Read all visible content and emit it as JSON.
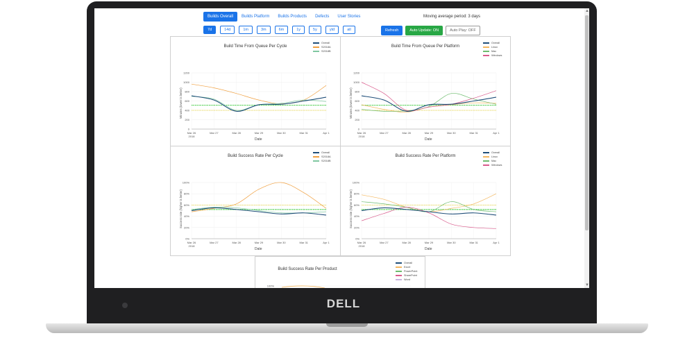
{
  "device": {
    "logo": "DELL"
  },
  "nav": {
    "tabs": [
      {
        "label": "Builds Overall",
        "active": true
      },
      {
        "label": "Builds Platform",
        "active": false
      },
      {
        "label": "Builds Products",
        "active": false
      },
      {
        "label": "Defects",
        "active": false
      },
      {
        "label": "User Stories",
        "active": false
      }
    ],
    "moving_average": "Moving average period: 3 days"
  },
  "periods": [
    {
      "label": "7d",
      "active": true
    },
    {
      "label": "14d",
      "active": false
    },
    {
      "label": "1m",
      "active": false
    },
    {
      "label": "3m",
      "active": false
    },
    {
      "label": "6m",
      "active": false
    },
    {
      "label": "1y",
      "active": false
    },
    {
      "label": "5y",
      "active": false
    },
    {
      "label": "ytd",
      "active": false
    },
    {
      "label": "all",
      "active": false
    }
  ],
  "controls": {
    "refresh": "Refresh",
    "auto_update": "Auto Update: ON",
    "auto_play": "Auto Play: OFF"
  },
  "colors": {
    "Overall": "#1f4e79",
    "S2018A": "#f0a040",
    "S2018B": "#7fc7a0",
    "Linux": "#f4b860",
    "Mac": "#6dbb6d",
    "Windows": "#d95b8c",
    "Excel": "#f4b860",
    "PowerPoint": "#6dbb6d",
    "SharePoint": "#d95b8c",
    "Word": "#c9b3e0",
    "target_yellow": "#e8d230",
    "target_green": "#38c838"
  },
  "chart_data": [
    {
      "type": "line",
      "title": "Build Time From Queue Per Cycle",
      "xlabel": "Date",
      "ylabel": "Minutes (lower is better)",
      "x": [
        "Mar 26",
        "Mar 27",
        "Mar 28",
        "Mar 29",
        "Mar 30",
        "Mar 31",
        "Apr 1"
      ],
      "x_first_sub": "2018",
      "yticks": [
        "0",
        "200",
        "400",
        "600",
        "800",
        "1000",
        "1200"
      ],
      "ylim": [
        0,
        1200
      ],
      "series": [
        {
          "name": "Overall",
          "values": [
            710,
            620,
            380,
            520,
            530,
            600,
            680
          ]
        },
        {
          "name": "S2018A",
          "values": [
            960,
            880,
            760,
            620,
            540,
            620,
            930
          ]
        },
        {
          "name": "S2018B",
          "values": [
            700,
            640,
            400,
            520,
            550,
            620,
            590
          ]
        }
      ],
      "targets": [
        {
          "color": "yellow",
          "value": 400
        },
        {
          "color": "green",
          "value": 510
        }
      ]
    },
    {
      "type": "line",
      "title": "Build Time From Queue Per Platform",
      "xlabel": "Date",
      "ylabel": "Minutes (lower is better)",
      "x": [
        "Mar 26",
        "Mar 27",
        "Mar 28",
        "Mar 29",
        "Mar 30",
        "Mar 31",
        "Apr 1"
      ],
      "x_first_sub": "2018",
      "yticks": [
        "0",
        "200",
        "400",
        "600",
        "800",
        "1000",
        "1200"
      ],
      "ylim": [
        0,
        1200
      ],
      "series": [
        {
          "name": "Overall",
          "values": [
            710,
            620,
            380,
            520,
            530,
            600,
            680
          ]
        },
        {
          "name": "Linux",
          "values": [
            520,
            420,
            360,
            470,
            520,
            560,
            550
          ]
        },
        {
          "name": "Mac",
          "values": [
            420,
            380,
            390,
            480,
            760,
            640,
            530
          ]
        },
        {
          "name": "Windows",
          "values": [
            1000,
            760,
            400,
            470,
            530,
            660,
            820
          ]
        }
      ],
      "targets": [
        {
          "color": "yellow",
          "value": 400
        },
        {
          "color": "green",
          "value": 510
        }
      ]
    },
    {
      "type": "line",
      "title": "Build Success Rate Per Cycle",
      "xlabel": "Date",
      "ylabel": "Success rate (higher is better)",
      "x": [
        "Mar 26",
        "Mar 27",
        "Mar 28",
        "Mar 29",
        "Mar 30",
        "Mar 31",
        "Apr 1"
      ],
      "x_first_sub": "2018",
      "yticks": [
        "0%",
        "20%",
        "40%",
        "60%",
        "80%",
        "100%"
      ],
      "ylim": [
        0,
        100
      ],
      "series": [
        {
          "name": "Overall",
          "values": [
            50,
            55,
            52,
            48,
            44,
            46,
            42
          ]
        },
        {
          "name": "S2018A",
          "values": [
            48,
            54,
            62,
            88,
            100,
            82,
            54
          ]
        },
        {
          "name": "S2018B",
          "values": [
            52,
            56,
            55,
            50,
            46,
            46,
            48
          ]
        }
      ],
      "targets": [
        {
          "color": "yellow",
          "value": 60
        },
        {
          "color": "green",
          "value": 52
        }
      ]
    },
    {
      "type": "line",
      "title": "Build Success Rate Per Platform",
      "xlabel": "Date",
      "ylabel": "Success rate (higher is better)",
      "x": [
        "Mar 26",
        "Mar 27",
        "Mar 28",
        "Mar 29",
        "Mar 30",
        "Mar 31",
        "Apr 1"
      ],
      "x_first_sub": "2018",
      "yticks": [
        "0%",
        "20%",
        "40%",
        "60%",
        "80%",
        "100%"
      ],
      "ylim": [
        0,
        100
      ],
      "series": [
        {
          "name": "Overall",
          "values": [
            50,
            55,
            52,
            48,
            44,
            46,
            42
          ]
        },
        {
          "name": "Linux",
          "values": [
            78,
            70,
            56,
            48,
            54,
            62,
            80
          ]
        },
        {
          "name": "Mac",
          "values": [
            66,
            62,
            56,
            48,
            66,
            52,
            48
          ]
        },
        {
          "name": "Windows",
          "values": [
            32,
            45,
            56,
            46,
            26,
            20,
            18
          ]
        }
      ],
      "targets": [
        {
          "color": "yellow",
          "value": 60
        },
        {
          "color": "green",
          "value": 52
        }
      ]
    },
    {
      "type": "line",
      "title": "Build Success Rate Per Product",
      "yticks": [
        "100%"
      ],
      "ylim": [
        0,
        100
      ],
      "series": [
        {
          "name": "Overall"
        },
        {
          "name": "Excel"
        },
        {
          "name": "PowerPoint"
        },
        {
          "name": "SharePoint"
        },
        {
          "name": "Word"
        }
      ]
    }
  ]
}
